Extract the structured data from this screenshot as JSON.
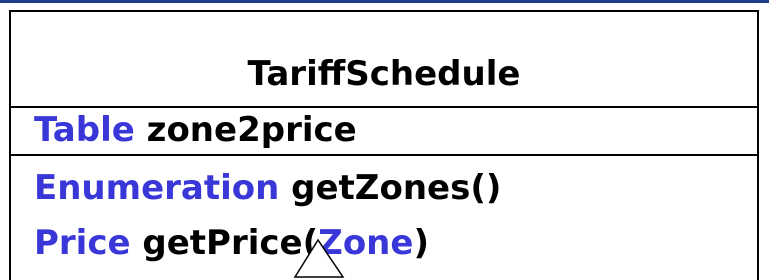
{
  "class_name": "TariffSchedule",
  "attributes": [
    {
      "type": "Table",
      "name": "zone2price"
    }
  ],
  "operations": [
    {
      "return_type": "Enumeration",
      "name": "getZones",
      "open": "(",
      "param": "",
      "close": ")"
    },
    {
      "return_type": "Price",
      "name": "getPrice",
      "open": "(",
      "param": "Zone",
      "close": ")"
    }
  ],
  "colors": {
    "type_keyword": "#3a37d8",
    "identifier": "#000000",
    "border": "#000000",
    "top_rule": "#1f3b8a"
  }
}
